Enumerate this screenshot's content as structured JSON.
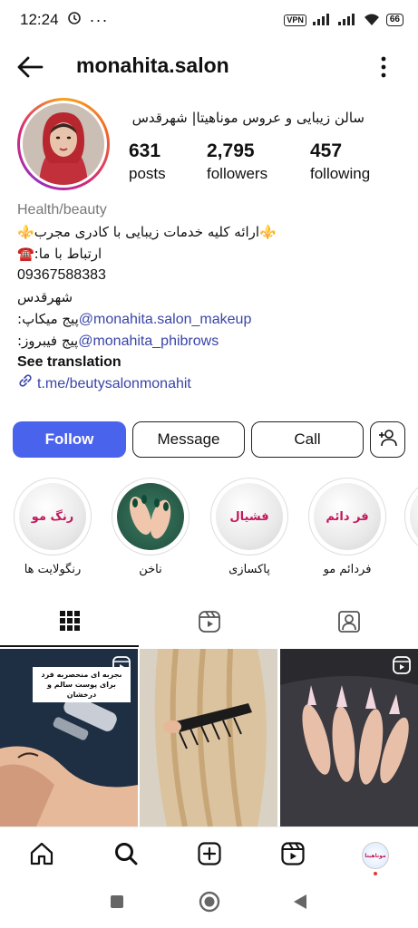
{
  "status": {
    "time": "12:24",
    "vpn": "VPN",
    "battery": "66"
  },
  "header": {
    "username": "monahita.salon"
  },
  "profile": {
    "full_name": "سالن زیبایی و عروس موناهیتا| شهرقدس",
    "stats": [
      {
        "value": "631",
        "label": "posts"
      },
      {
        "value": "2,795",
        "label": "followers"
      },
      {
        "value": "457",
        "label": "following"
      }
    ]
  },
  "bio": {
    "category": "Health/beauty",
    "line1": "⚜️ارائه کلیه خدمات زیبایی با کادری مجرب⚜️",
    "line2": "☎️:ارتباط با ما",
    "phone": "09367588383",
    "city": "شهرقدس",
    "makeup_prefix": ":پیج میکاپ",
    "makeup_handle": "@monahita.salon_makeup",
    "phibrows_prefix": ":پیج فیبروز",
    "phibrows_handle": "@monahita_phibrows",
    "see_translation": "See translation",
    "link": "t.me/beutysalonmonahit"
  },
  "actions": {
    "follow": "Follow",
    "message": "Message",
    "call": "Call"
  },
  "highlights": [
    {
      "cover_text": "رنگ مو",
      "label": "رنگولایت ها"
    },
    {
      "cover_text": "",
      "label": "ناخن"
    },
    {
      "cover_text": "فشیال",
      "label": "پاکسازی"
    },
    {
      "cover_text": "فر دائم",
      "label": "فردائم مو"
    }
  ],
  "posts": {
    "caption1": "تجربه ای منحصربه فرد برای پوست سالم و درخشان"
  },
  "profile_thumb_text": "موناهیتا",
  "colors": {
    "follow_button": "#4a63ec",
    "link": "#3a45a8",
    "highlight_text": "#c2185b"
  }
}
